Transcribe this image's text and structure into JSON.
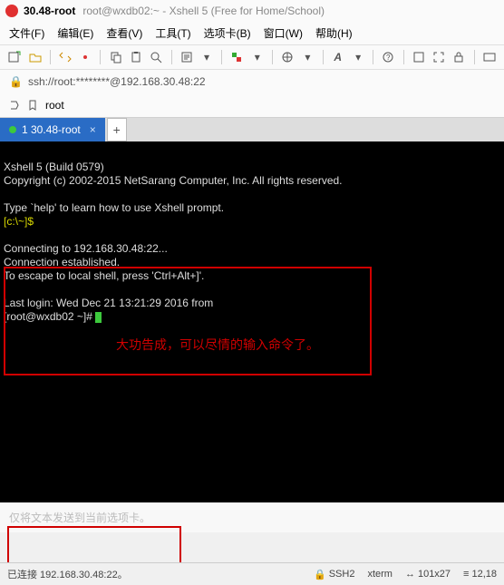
{
  "window": {
    "title": "30.48-root",
    "subtitle": "root@wxdb02:~ - Xshell 5 (Free for Home/School)"
  },
  "menu": {
    "file": "文件(F)",
    "edit": "编辑(E)",
    "view": "查看(V)",
    "tools": "工具(T)",
    "tabs": "选项卡(B)",
    "window": "窗口(W)",
    "help": "帮助(H)"
  },
  "address": {
    "text": "ssh://root:********@192.168.30.48:22"
  },
  "tag": {
    "label": "root"
  },
  "tab": {
    "label": "1 30.48-root"
  },
  "term": {
    "l1": "Xshell 5 (Build 0579)",
    "l2": "Copyright (c) 2002-2015 NetSarang Computer, Inc. All rights reserved.",
    "l3": "Type `help' to learn how to use Xshell prompt.",
    "l4": "[c:\\~]$",
    "l5": "Connecting to 192.168.30.48:22...",
    "l6": "Connection established.",
    "l7": "To escape to local shell, press 'Ctrl+Alt+]'.",
    "l8": "Last login: Wed Dec 21 13:21:29 2016 from ",
    "l9": "[root@wxdb02 ~]# ",
    "annotation": "大功告成，可以尽情的输入命令了。"
  },
  "inputhint": "仅将文本发送到当前选项卡。",
  "status": {
    "conn": "已连接 192.168.30.48:22。",
    "proto": "SSH2",
    "term": "xterm",
    "size": "101x27",
    "pos": "12,18"
  }
}
